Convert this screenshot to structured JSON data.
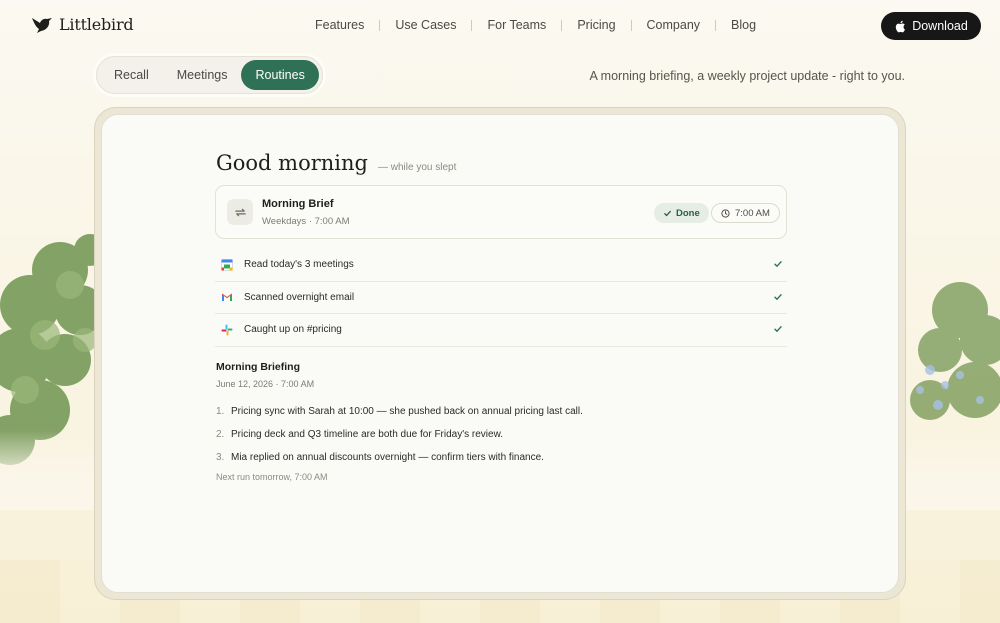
{
  "brand": {
    "name": "Littlebird"
  },
  "nav": {
    "items": [
      {
        "label": "Features"
      },
      {
        "label": "Use Cases"
      },
      {
        "label": "For Teams"
      },
      {
        "label": "Pricing"
      },
      {
        "label": "Company"
      },
      {
        "label": "Blog"
      }
    ],
    "download_label": "Download"
  },
  "tabs": {
    "items": [
      {
        "label": "Recall"
      },
      {
        "label": "Meetings"
      },
      {
        "label": "Routines",
        "active": true
      }
    ],
    "tagline": "A morning briefing, a weekly project update - right to you."
  },
  "app": {
    "greeting": "Good morning",
    "greeting_sub": "— while you slept",
    "routine": {
      "name": "Morning Brief",
      "schedule": "Weekdays · 7:00 AM",
      "status": "Done",
      "time": "7:00 AM",
      "icon": "repeat-icon"
    },
    "steps": [
      {
        "label": "Read today's 3 meetings",
        "icon": "google-calendar-icon",
        "done": true
      },
      {
        "label": "Scanned overnight email",
        "icon": "gmail-icon",
        "done": true
      },
      {
        "label": "Caught up on #pricing",
        "icon": "slack-icon",
        "done": true
      }
    ],
    "briefing": {
      "title": "Morning Briefing",
      "date": "June 12, 2026 · 7:00 AM",
      "items": [
        {
          "num": "1.",
          "text": "Pricing sync with Sarah at 10:00 — she pushed back on annual pricing last call."
        },
        {
          "num": "2.",
          "text": "Pricing deck and Q3 timeline are both due for Friday's review."
        },
        {
          "num": "3.",
          "text": "Mia replied on annual discounts overnight — confirm tiers with finance."
        }
      ],
      "next_run": "Next run tomorrow, 7:00 AM"
    }
  },
  "colors": {
    "accent": "#2e7156",
    "done_bg": "#e5ede4",
    "done_text": "#2d5f41",
    "download_bg": "#171717"
  }
}
